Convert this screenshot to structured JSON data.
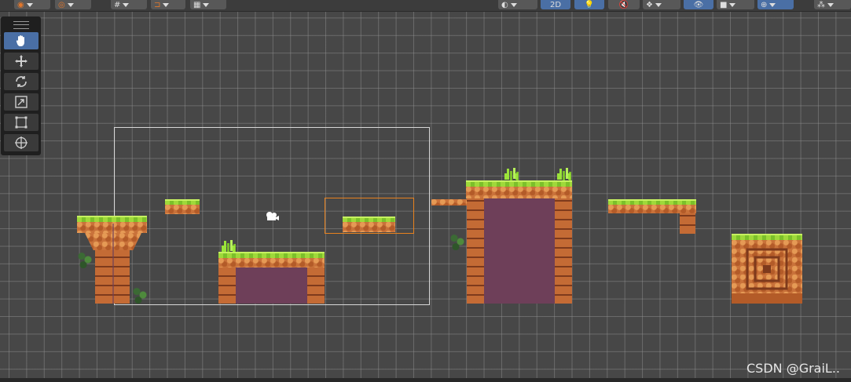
{
  "toolbar": {
    "left_buttons": [
      {
        "icon": "transform-gizmo-icon"
      },
      {
        "icon": "pivot-icon"
      },
      {
        "icon": "grid-snap-icon"
      },
      {
        "icon": "snap-increment-icon"
      },
      {
        "icon": "ruler-icon"
      }
    ],
    "right_buttons": [
      {
        "icon": "draw-mode-icon"
      },
      {
        "label": "2D",
        "active": true
      },
      {
        "icon": "lighting-icon",
        "active": true
      },
      {
        "icon": "audio-mute-icon"
      },
      {
        "icon": "effects-icon"
      },
      {
        "icon": "scene-visibility-icon",
        "active": true
      },
      {
        "icon": "camera-icon"
      },
      {
        "icon": "gizmos-icon",
        "active": true
      },
      {
        "icon": "layers-icon"
      }
    ]
  },
  "tools": [
    {
      "name": "hand-tool",
      "icon": "hand-icon",
      "active": true
    },
    {
      "name": "move-tool",
      "icon": "move-arrows-icon"
    },
    {
      "name": "rotate-tool",
      "icon": "rotate-icon"
    },
    {
      "name": "scale-tool",
      "icon": "scale-icon"
    },
    {
      "name": "rect-tool",
      "icon": "rect-transform-icon"
    },
    {
      "name": "transform-tool",
      "icon": "transform-icon"
    }
  ],
  "watermark": "CSDN @GraiL..",
  "colors": {
    "background": "#474747",
    "grid": "#969696",
    "active_blue": "#4a6fa5",
    "selection_orange": "#e8821e",
    "camera_frame": "#d8d8d8"
  }
}
